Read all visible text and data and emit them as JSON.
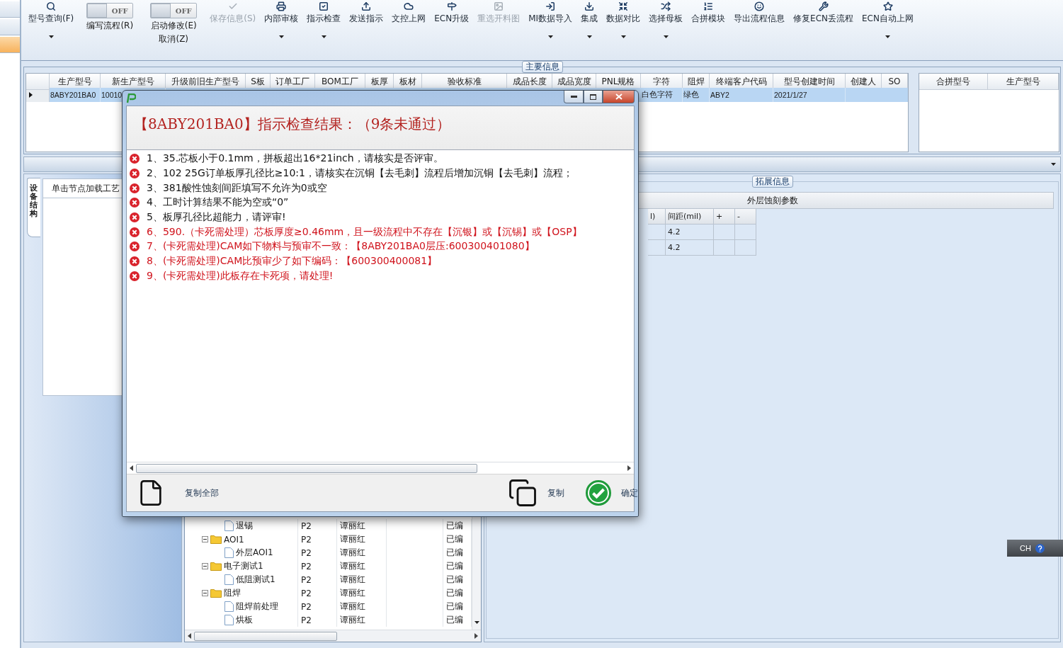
{
  "side_tabs": [
    {
      "selected": false
    },
    {
      "selected": false
    },
    {
      "selected": true
    }
  ],
  "toolbar": [
    {
      "kind": "button",
      "label": "型号查询(F)",
      "has_menu": true,
      "disabled": false
    },
    {
      "kind": "toggle",
      "state_text": "OFF",
      "on": false,
      "labels": [
        "编写流程(R)"
      ]
    },
    {
      "kind": "toggle",
      "state_text": "OFF",
      "on": false,
      "labels": [
        "启动修改(E)",
        "取消(Z)"
      ]
    },
    {
      "kind": "button",
      "label": "保存信息(S)",
      "has_menu": false,
      "disabled": true
    },
    {
      "kind": "button",
      "label": "内部审核",
      "has_menu": true,
      "disabled": false
    },
    {
      "kind": "button",
      "label": "指示检查",
      "has_menu": true,
      "disabled": false
    },
    {
      "kind": "button",
      "label": "发送指示",
      "has_menu": false,
      "disabled": false
    },
    {
      "kind": "button",
      "label": "文控上网",
      "has_menu": false,
      "disabled": false
    },
    {
      "kind": "button",
      "label": "ECN升级",
      "has_menu": false,
      "disabled": false
    },
    {
      "kind": "button",
      "label": "重选开料图",
      "has_menu": false,
      "disabled": true
    },
    {
      "kind": "button",
      "label": "MI数据导入",
      "has_menu": true,
      "disabled": false
    },
    {
      "kind": "button",
      "label": "集成",
      "has_menu": true,
      "disabled": false
    },
    {
      "kind": "button",
      "label": "数据对比",
      "has_menu": true,
      "disabled": false
    },
    {
      "kind": "button",
      "label": "选择母板",
      "has_menu": true,
      "disabled": false
    },
    {
      "kind": "button",
      "label": "合拼模块",
      "has_menu": false,
      "disabled": false
    },
    {
      "kind": "button",
      "label": "导出流程信息",
      "has_menu": false,
      "disabled": false
    },
    {
      "kind": "button",
      "label": "修复ECN丢流程",
      "has_menu": false,
      "disabled": false
    },
    {
      "kind": "button",
      "label": "ECN自动上网",
      "has_menu": true,
      "disabled": false
    }
  ],
  "main_info": {
    "legend": "主要信息",
    "table": {
      "columns": [
        "生产型号",
        "新生产型号",
        "升级前旧生产型号",
        "S板",
        "订单工厂",
        "BOM工厂",
        "板厚",
        "板材",
        "验收标准",
        "成品长度",
        "成品宽度",
        "PNL规格",
        "字符",
        "阻焊",
        "终端客户代码",
        "型号创建时间",
        "创建人",
        "SO"
      ],
      "rows": [
        {
          "selected": true,
          "left_cells": [
            "8ABY201BA0",
            "10010"
          ],
          "right_cells": [
            "白色字符",
            "绿色",
            "ABY2",
            "2021/1/27"
          ]
        }
      ]
    },
    "merge_table": {
      "columns": [
        "合拼型号",
        "生产型号"
      ]
    }
  },
  "left_panel": {
    "tab": "设备结构",
    "header": "单击节点加载工艺"
  },
  "process_tree": [
    {
      "children": [
        {
          "name": "退锡",
          "column_2": "P2",
          "column_3": "谭丽红",
          "column_5": "已编"
        }
      ]
    },
    {
      "name": "AOI1",
      "expanded": true,
      "column_2": "P2",
      "column_3": "谭丽红",
      "column_5": "已编",
      "children": [
        {
          "name": "外层AOI1",
          "column_2": "P2",
          "column_3": "谭丽红",
          "column_5": "已编"
        }
      ]
    },
    {
      "name": "电子测试1",
      "expanded": true,
      "column_2": "P2",
      "column_3": "谭丽红",
      "column_5": "已编",
      "children": [
        {
          "name": "低阻测试1",
          "column_2": "P2",
          "column_3": "谭丽红",
          "column_5": "已编"
        }
      ]
    },
    {
      "name": "阻焊",
      "expanded": true,
      "column_2": "P2",
      "column_3": "谭丽红",
      "column_5": "已编",
      "children": [
        {
          "name": "阻焊前处理",
          "column_2": "P2",
          "column_3": "谭丽红",
          "column_5": "已编"
        },
        {
          "name": "烘板",
          "column_2": "P2",
          "column_3": "谭丽红",
          "column_5": "已编"
        }
      ]
    }
  ],
  "extended_info": {
    "legend": "拓展信息",
    "table": {
      "title": "外层蚀刻参数",
      "columns": [
        "l)",
        "间距(mil)",
        "+",
        "-"
      ],
      "rows": [
        {
          "column_2": "4.2"
        },
        {
          "column_2": "4.2"
        }
      ]
    }
  },
  "language_bar": {
    "text": "CH"
  },
  "dialog": {
    "heading": "【8ABY201BA0】指示检查结果：（9条未通过）",
    "issues": [
      {
        "blocking": false,
        "text": "1、35.芯板小于0.1mm，拼板超出16*21inch，请核实是否评审。"
      },
      {
        "blocking": false,
        "text": "2、102 25G订单板厚孔径比≥10:1，请核实在沉铜【去毛刺】流程后增加沉铜【去毛刺】流程；"
      },
      {
        "blocking": false,
        "text": "3、381酸性蚀刻间距填写不允许为0或空"
      },
      {
        "blocking": false,
        "text": "4、工时计算结果不能为空或“0”"
      },
      {
        "blocking": false,
        "text": "5、板厚孔径比超能力，请评审!"
      },
      {
        "blocking": true,
        "text": "6、590.（卡死需处理）芯板厚度≥0.46mm，且一级流程中不存在【沉银】或【沉锡】或【OSP】"
      },
      {
        "blocking": true,
        "text": "7、(卡死需处理)CAM如下物料与预审不一致：【8ABY201BA0层压:600300401080】"
      },
      {
        "blocking": true,
        "text": "8、(卡死需处理)CAM比预审少了如下编码：【600300400081】"
      },
      {
        "blocking": true,
        "text": "9、(卡死需处理)此板存在卡死项，请处理!"
      }
    ],
    "actions": [
      {
        "kind": "copy_all",
        "label": "复制全部"
      },
      {
        "kind": "copy",
        "label": "复制"
      },
      {
        "kind": "confirm",
        "label": "确定"
      }
    ]
  }
}
